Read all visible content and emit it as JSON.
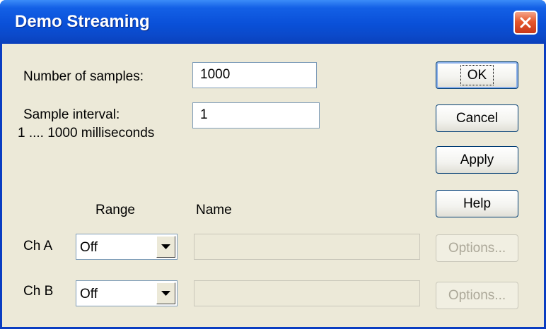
{
  "window": {
    "title": "Demo Streaming"
  },
  "settings": {
    "samples_label": "Number of samples:",
    "samples_value": "1000",
    "interval_label": "Sample interval:",
    "interval_range": "1 .... 1000 milliseconds",
    "interval_value": "1"
  },
  "channels": {
    "range_header": "Range",
    "name_header": "Name",
    "rows": [
      {
        "label": "Ch A",
        "range": "Off",
        "name": "",
        "options": "Options..."
      },
      {
        "label": "Ch B",
        "range": "Off",
        "name": "",
        "options": "Options..."
      }
    ]
  },
  "buttons": {
    "ok": "OK",
    "cancel": "Cancel",
    "apply": "Apply",
    "help": "Help"
  },
  "colors": {
    "titlebar": "#0a50d8",
    "dialog_bg": "#ece9d8",
    "close_button": "#e5582d"
  }
}
